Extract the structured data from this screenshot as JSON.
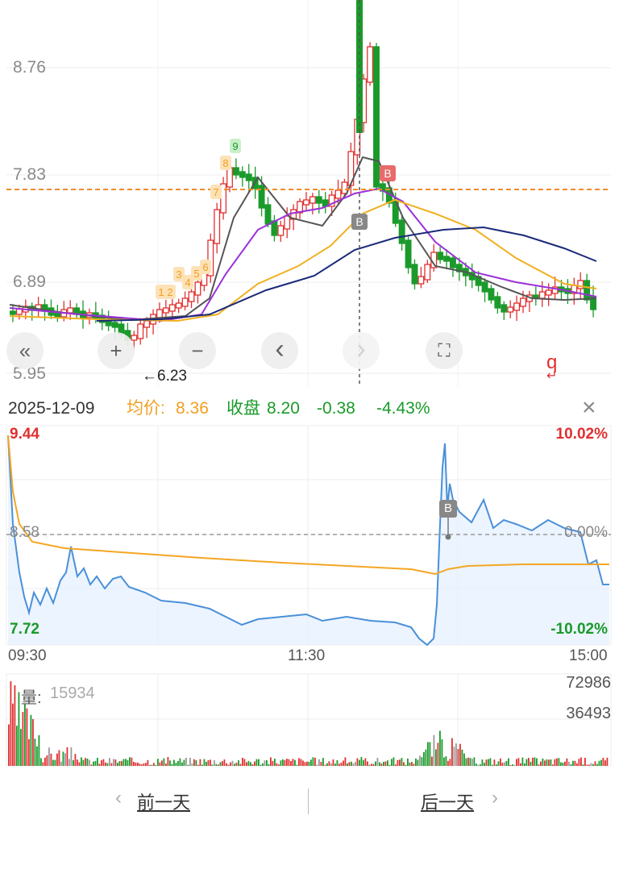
{
  "kline": {
    "y_labels": [
      "8.76",
      "7.83",
      "6.89",
      "5.95"
    ],
    "min_price_marker": "←6.23",
    "reference_line_color": "#f08c2a",
    "td_sequence_labels": [
      "1",
      "2",
      "3",
      "4",
      "5",
      "6",
      "7",
      "8",
      "9"
    ],
    "b_marker": "B",
    "s_marker": "B",
    "corner_icon": "q",
    "controls": [
      {
        "name": "scroll-left-fast-button",
        "icon": "double-chevron-left-icon",
        "glyph": "«"
      },
      {
        "name": "zoom-in-button",
        "icon": "plus-icon",
        "glyph": "+"
      },
      {
        "name": "zoom-out-button",
        "icon": "minus-icon",
        "glyph": "−"
      },
      {
        "name": "scroll-left-button",
        "icon": "chevron-left-icon",
        "glyph": "‹"
      },
      {
        "name": "scroll-right-button",
        "icon": "chevron-right-icon",
        "glyph": "›"
      },
      {
        "name": "fullscreen-button",
        "icon": "expand-icon",
        "glyph": "⛶"
      }
    ]
  },
  "info": {
    "date": "2025-12-09",
    "avg_label": "均价:",
    "avg_value": "8.36",
    "close_label": "收盘",
    "close_value": "8.20",
    "change": "-0.38",
    "change_pct": "-4.43%",
    "close_icon": "close-icon"
  },
  "intraday": {
    "high_price": "9.44",
    "low_price": "7.72",
    "ref_price": "8.58",
    "high_pct": "10.02%",
    "low_pct": "-10.02%",
    "ref_pct": "0.00%",
    "times": [
      "09:30",
      "11:30",
      "15:00"
    ],
    "b_marker": "B"
  },
  "volume": {
    "label": "量:",
    "value": "15934",
    "max_label": "72986",
    "mid_label": "36493"
  },
  "nav": {
    "prev": "前一天",
    "next": "后一天"
  },
  "colors": {
    "up": "#e03030",
    "down": "#1a9a2a",
    "avg": "#f5a623",
    "price_line": "#4a90d9",
    "ma_gray": "#555555",
    "ma_purple": "#9b30d9",
    "ma_orange": "#f0b020",
    "ma_navy": "#1a2a7a"
  }
}
